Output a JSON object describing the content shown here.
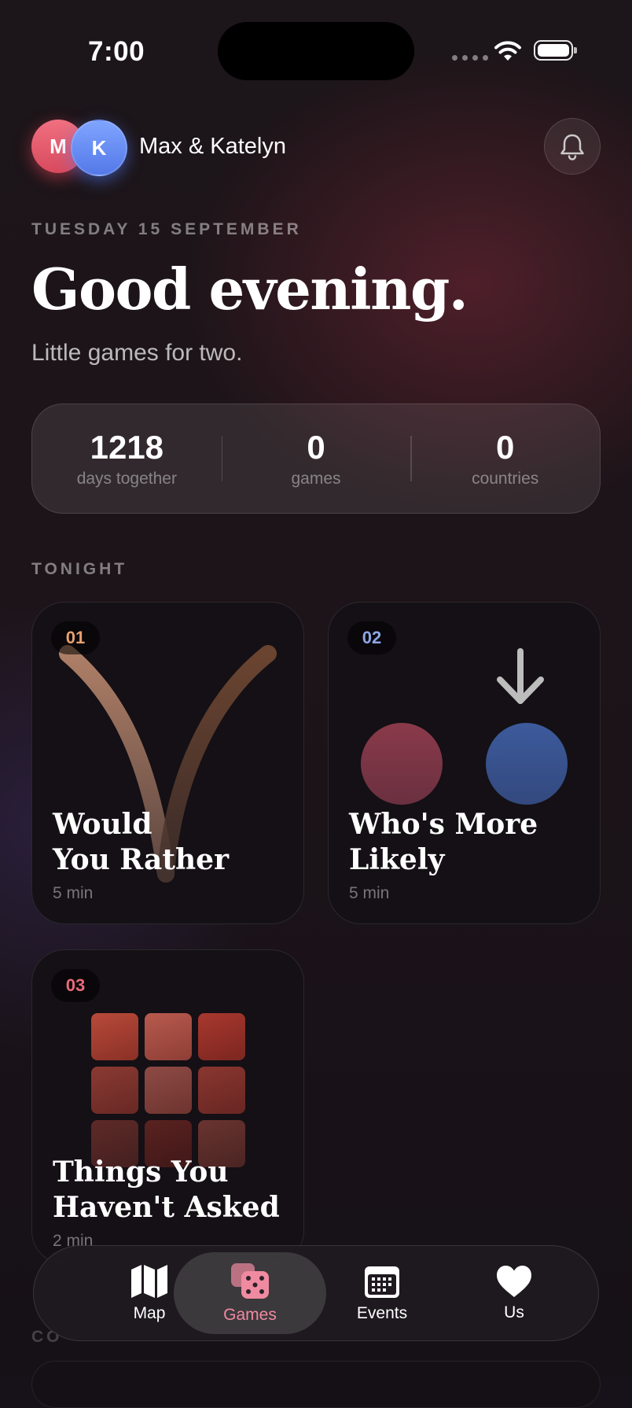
{
  "status_bar": {
    "time": "7:00"
  },
  "header": {
    "avatars": [
      {
        "initial": "M",
        "color": "#e85a6e"
      },
      {
        "initial": "K",
        "color": "#6a8cf2"
      }
    ],
    "couple_name": "Max & Katelyn",
    "bell_icon": "bell-icon"
  },
  "date_label": "TUESDAY 15 SEPTEMBER",
  "greeting": "Good evening.",
  "subtitle": "Little games for two.",
  "stats": [
    {
      "value": "1218",
      "label": "days together"
    },
    {
      "value": "0",
      "label": "games"
    },
    {
      "value": "0",
      "label": "countries"
    }
  ],
  "section_tonight": "TONIGHT",
  "games": [
    {
      "number": "01",
      "title_line1": "Would",
      "title_line2": "You Rather",
      "duration": "5 min",
      "number_color": "#e8a070"
    },
    {
      "number": "02",
      "title_line1": "Who's More",
      "title_line2": "Likely",
      "duration": "5 min",
      "number_color": "#8fa6e8"
    },
    {
      "number": "03",
      "title_line1": "Things You",
      "title_line2": "Haven't Asked",
      "duration": "2 min",
      "number_color": "#e86a7a"
    }
  ],
  "section_next_partial": "CO",
  "tabbar": {
    "tabs": [
      {
        "label": "Map",
        "icon": "map-icon",
        "active": false
      },
      {
        "label": "Games",
        "icon": "dice-icon",
        "active": true
      },
      {
        "label": "Events",
        "icon": "calendar-icon",
        "active": false
      },
      {
        "label": "Us",
        "icon": "heart-icon",
        "active": false
      }
    ]
  }
}
